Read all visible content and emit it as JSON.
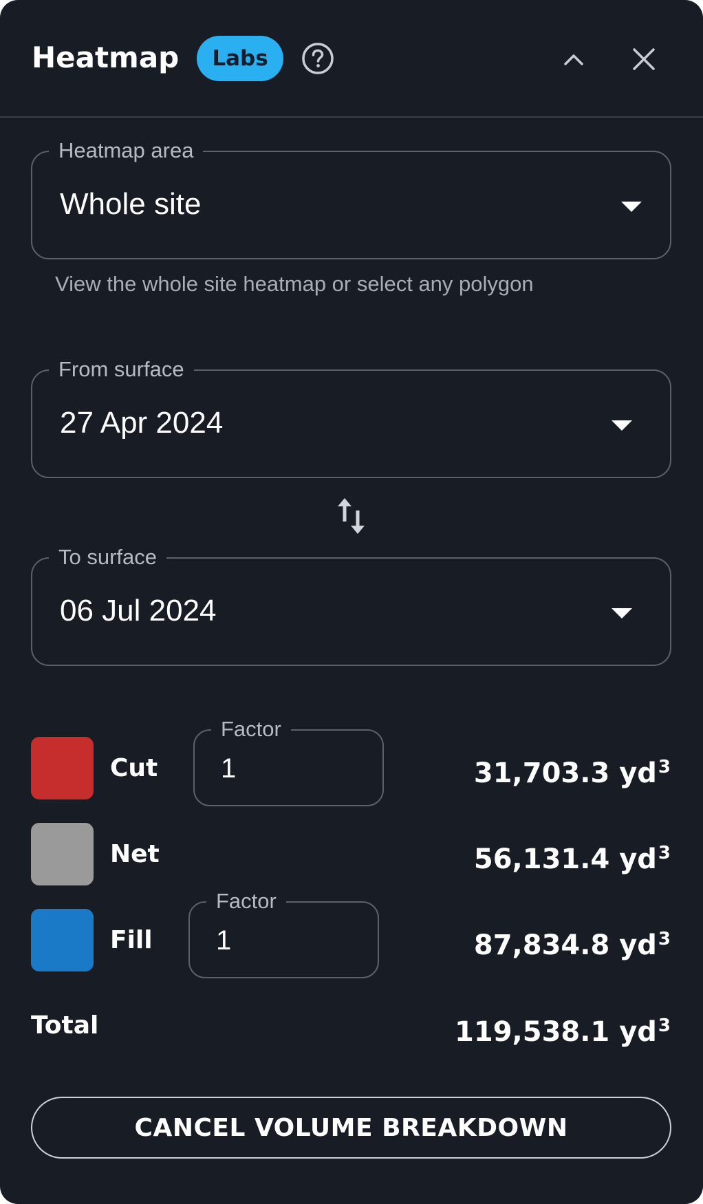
{
  "header": {
    "title": "Heatmap",
    "badge": "Labs",
    "help_icon": "help-circle-icon",
    "collapse_icon": "chevron-up-icon",
    "close_icon": "close-icon"
  },
  "heatmap_area": {
    "label": "Heatmap area",
    "value": "Whole site",
    "helper": "View the whole site heatmap or select any polygon"
  },
  "from_surface": {
    "label": "From surface",
    "value": "27 Apr 2024"
  },
  "swap_icon": "swap-vertical-icon",
  "to_surface": {
    "label": "To surface",
    "value": "06 Jul 2024"
  },
  "volumes": {
    "cut": {
      "label": "Cut",
      "color": "#c62d2d",
      "factor_label": "Factor",
      "factor_value": "1",
      "value": "31,703.3 yd",
      "unit_exp": "3"
    },
    "net": {
      "label": "Net",
      "color": "#9a9a9a",
      "value": "56,131.4 yd",
      "unit_exp": "3"
    },
    "fill": {
      "label": "Fill",
      "color": "#1a7ac8",
      "factor_label": "Factor",
      "factor_value": "1",
      "value": "87,834.8 yd",
      "unit_exp": "3"
    },
    "total": {
      "label": "Total",
      "value": "119,538.1 yd",
      "unit_exp": "3"
    }
  },
  "cancel_button": "CANCEL VOLUME BREAKDOWN",
  "colors": {
    "panel_bg": "#181d25",
    "badge_bg": "#2ab0f0",
    "outline": "#5a616b"
  }
}
